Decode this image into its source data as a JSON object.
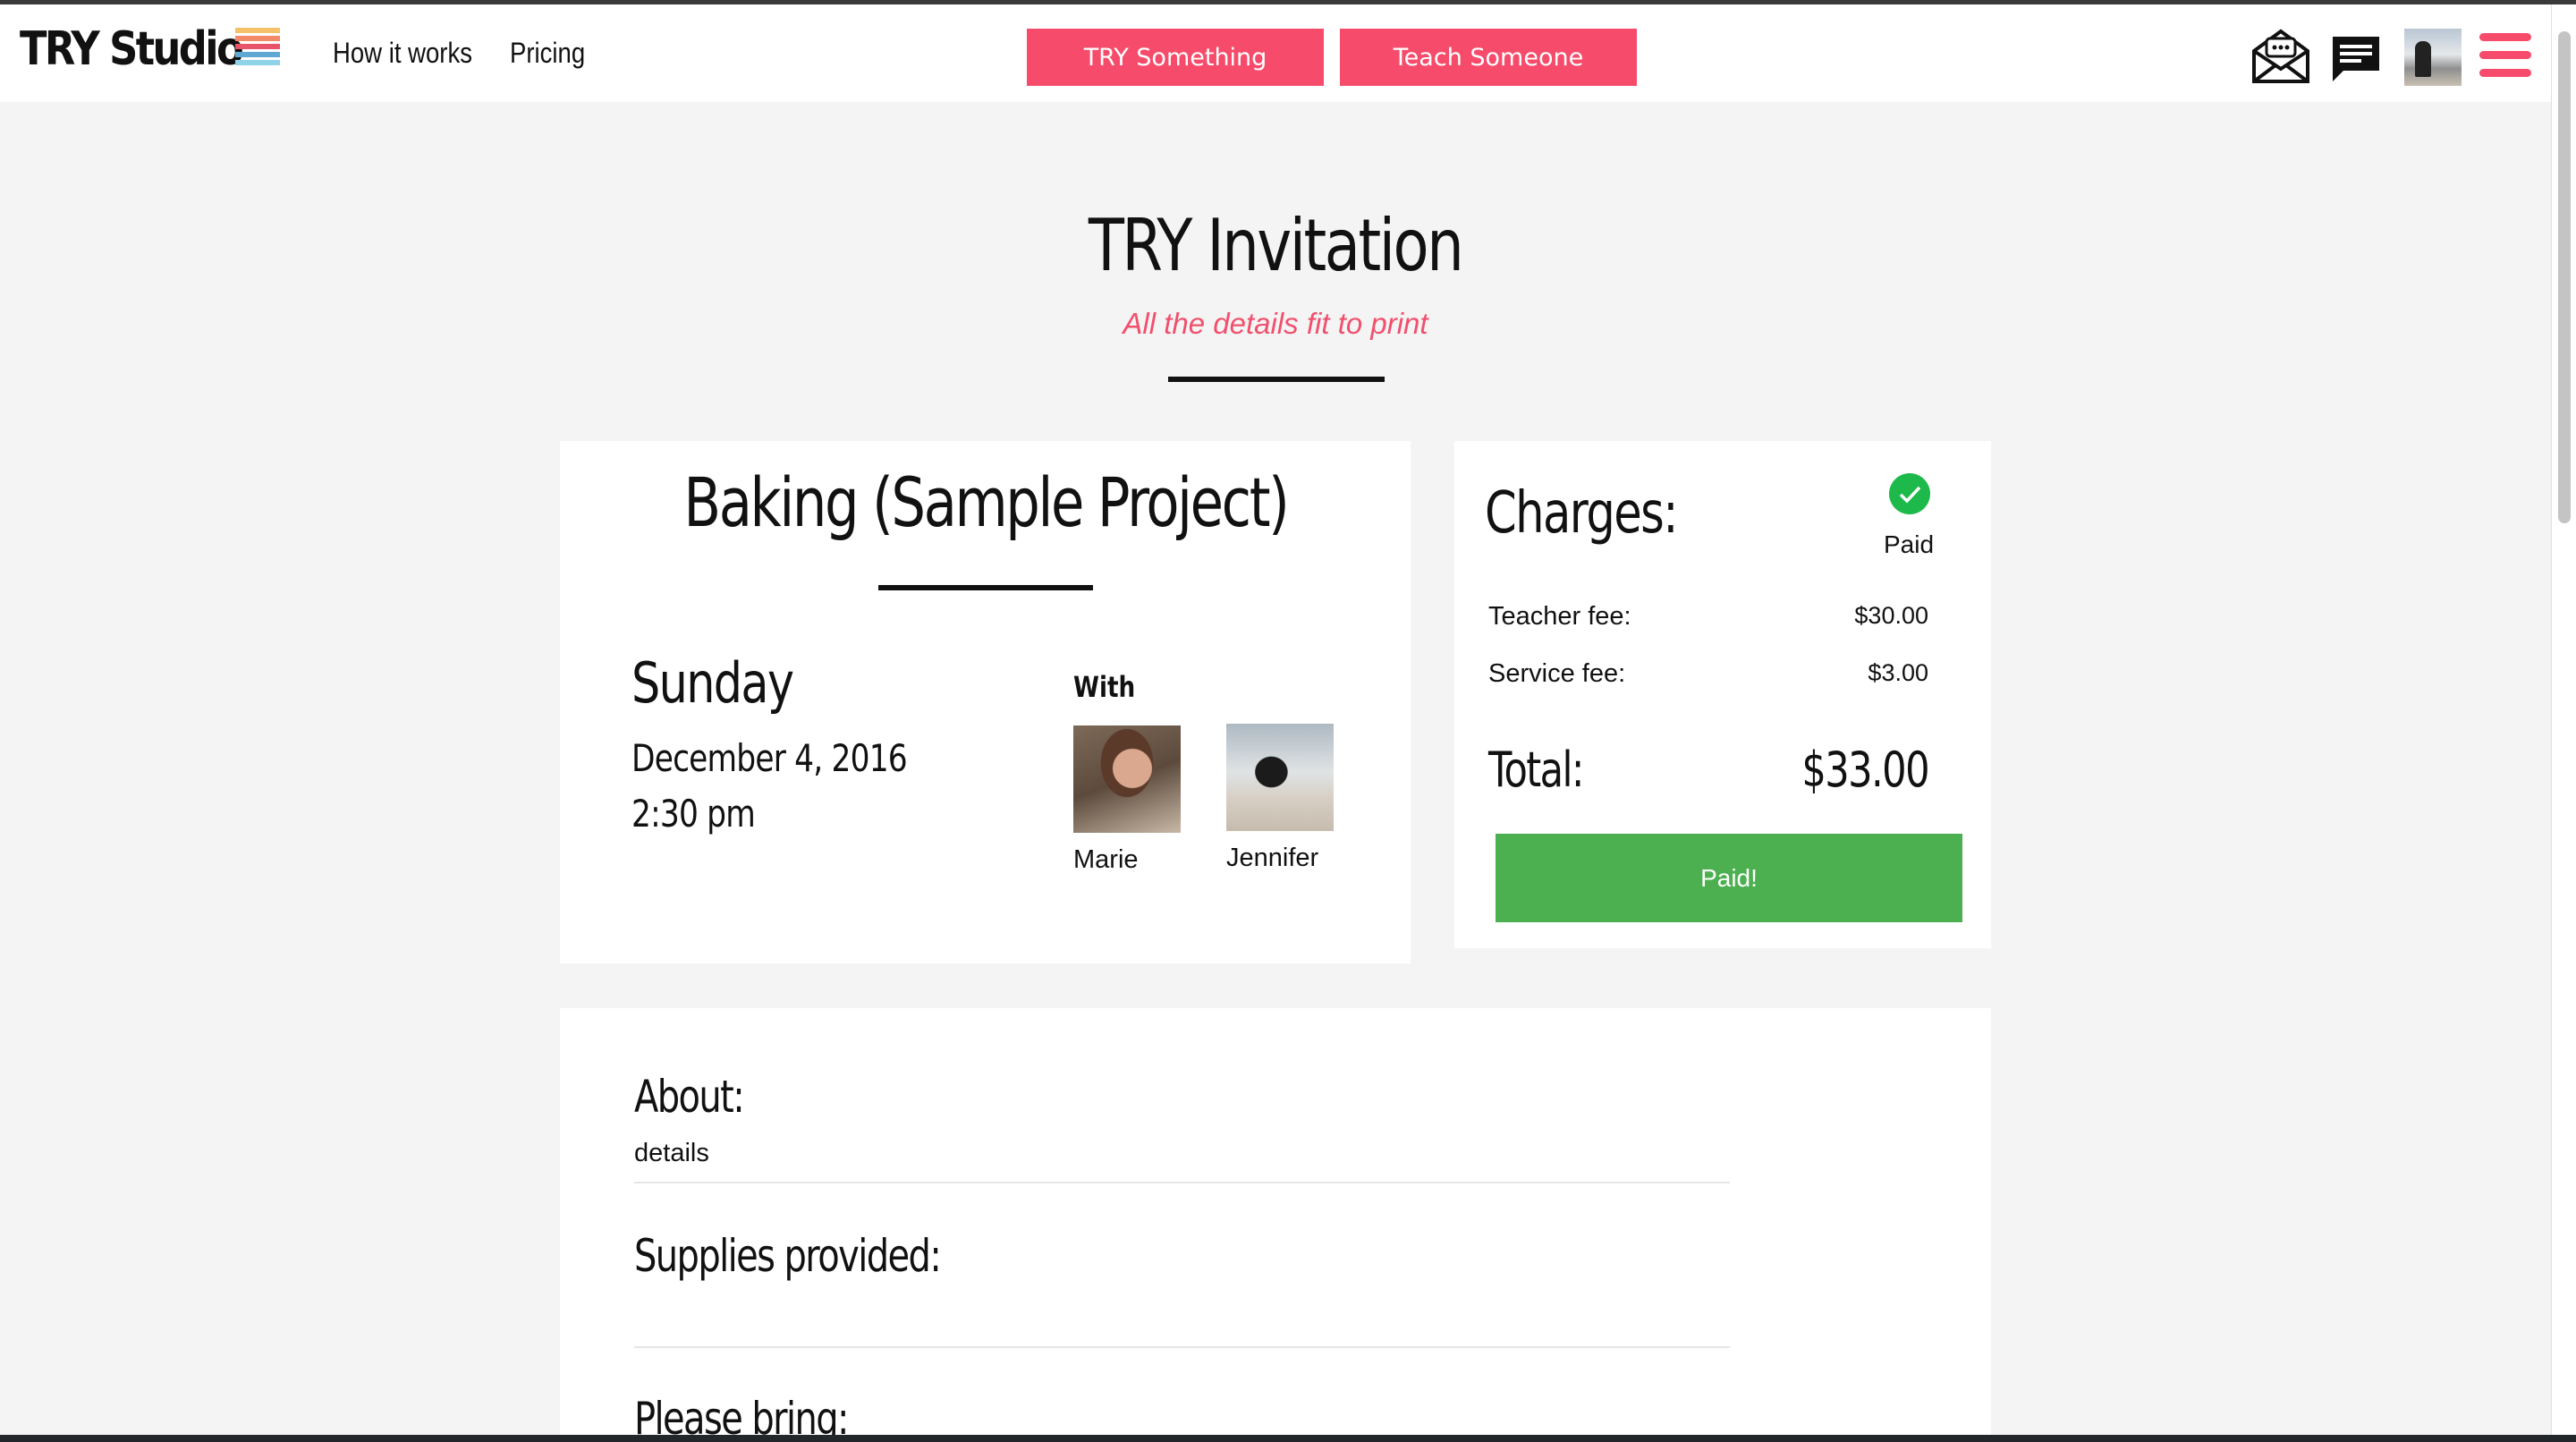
{
  "header": {
    "logo": "TRY Studio",
    "logo_colors": [
      "#f5c26b",
      "#f28a6a",
      "#e8556b",
      "#5fa8d3",
      "#8fd3e8"
    ],
    "nav": [
      "How it works",
      "Pricing"
    ],
    "try_button": "TRY Something",
    "teach_button": "Teach Someone",
    "icons": [
      "envelope-icon",
      "chat-icon",
      "profile-avatar",
      "hamburger-menu-icon"
    ]
  },
  "page": {
    "title": "TRY Invitation",
    "subtitle": "All the details fit to print"
  },
  "project": {
    "title": "Baking (Sample Project)",
    "day": "Sunday",
    "date": "December 4, 2016",
    "time": "2:30 pm",
    "with_label": "With",
    "people": [
      "Marie",
      "Jennifer"
    ]
  },
  "charges": {
    "title": "Charges:",
    "status": "Paid",
    "fees": [
      {
        "label": "Teacher fee:",
        "value": "$30.00"
      },
      {
        "label": "Service fee:",
        "value": "$3.00"
      }
    ],
    "total_label": "Total:",
    "total_value": "$33.00",
    "button": "Paid!"
  },
  "details": {
    "about_heading": "About:",
    "about_text": "details",
    "supplies_heading": "Supplies provided:",
    "bring_heading": "Please bring:"
  },
  "colors": {
    "accent": "#f74b6b",
    "paid_green": "#4caf50",
    "check_green": "#1db94a",
    "background": "#f4f4f4"
  }
}
